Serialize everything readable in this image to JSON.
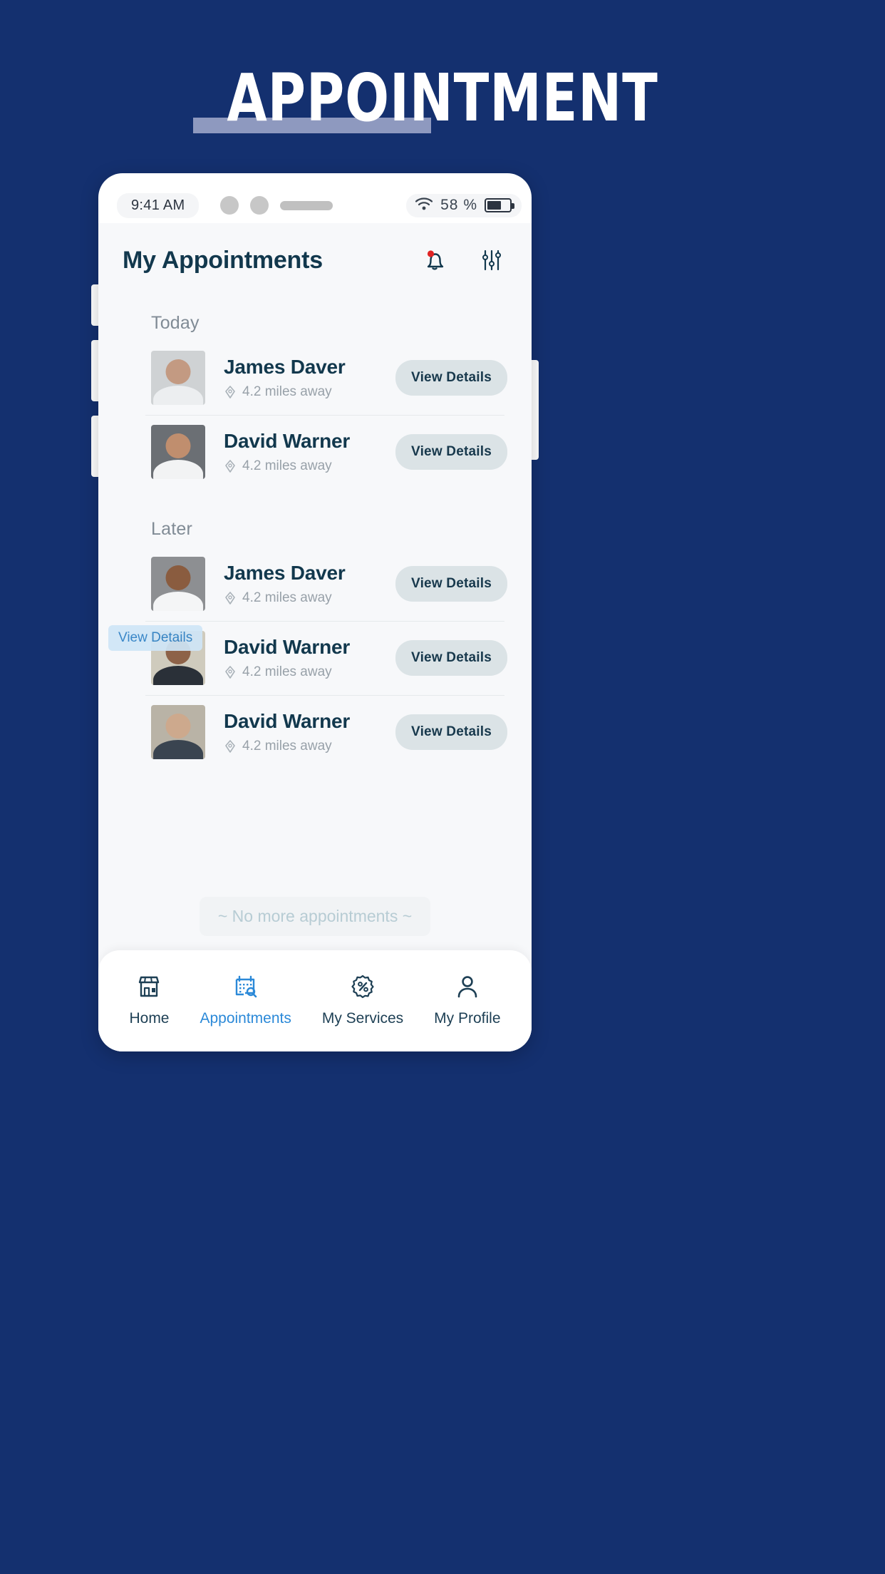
{
  "hero": {
    "title": "APPOINTMENT",
    "underline_color": "#8e99bf",
    "background": "#14306f"
  },
  "statusbar": {
    "time": "9:41 AM",
    "battery_percent": "58 %",
    "wifi_icon": "wifi-icon",
    "battery_icon": "battery-icon"
  },
  "header": {
    "title": "My Appointments",
    "notification_icon": "bell-icon",
    "filter_icon": "sliders-icon",
    "badge_color": "#e02424"
  },
  "groups": [
    {
      "label": "Today",
      "items": [
        {
          "name": "James Daver",
          "distance": "4.2 miles away",
          "button": "View Details",
          "pin_icon": "location-pin-icon",
          "avatar": "a1"
        },
        {
          "name": "David Warner",
          "distance": "4.2 miles away",
          "button": "View Details",
          "pin_icon": "location-pin-icon",
          "avatar": "a2"
        }
      ]
    },
    {
      "label": "Later",
      "items": [
        {
          "name": "James Daver",
          "distance": "4.2 miles away",
          "button": "View Details",
          "pin_icon": "location-pin-icon",
          "avatar": "a3"
        },
        {
          "name": "David Warner",
          "distance": "4.2 miles away",
          "button": "View Details",
          "pin_icon": "location-pin-icon",
          "avatar": "a4",
          "tooltip": "View Details"
        },
        {
          "name": "David Warner",
          "distance": "4.2 miles away",
          "button": "View Details",
          "pin_icon": "location-pin-icon",
          "avatar": "a5"
        }
      ]
    }
  ],
  "footer": {
    "end_of_list": "~ No more appointments ~"
  },
  "bottom_nav": {
    "active_color": "#2b89d8",
    "inactive_color": "#1d3f54",
    "items": [
      {
        "label": "Home",
        "icon": "store-icon",
        "active": false
      },
      {
        "label": "Appointments",
        "icon": "calendar-search-icon",
        "active": true
      },
      {
        "label": "My Services",
        "icon": "percent-badge-icon",
        "active": false
      },
      {
        "label": "My Profile",
        "icon": "user-icon",
        "active": false
      }
    ]
  }
}
